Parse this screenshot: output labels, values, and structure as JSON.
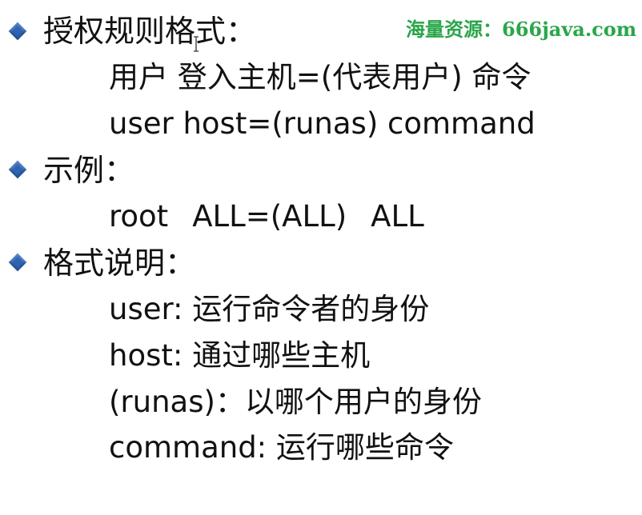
{
  "watermark": {
    "text": "海量资源：666java.com",
    "color": "#2aa64a"
  },
  "bullet_color": "#2e64b4",
  "sections": [
    {
      "heading": "授权规则格式：",
      "lines": [
        "用户 登入主机=(代表用户) 命令",
        "user host=(runas)  command"
      ]
    },
    {
      "heading": "示例：",
      "example": {
        "user": "root",
        "host_runas": "ALL=(ALL)",
        "command": "ALL"
      }
    },
    {
      "heading": "格式说明：",
      "lines": [
        "user: 运行命令者的身份",
        "host: 通过哪些主机",
        "(runas)：以哪个用户的身份",
        "command: 运行哪些命令"
      ]
    }
  ]
}
